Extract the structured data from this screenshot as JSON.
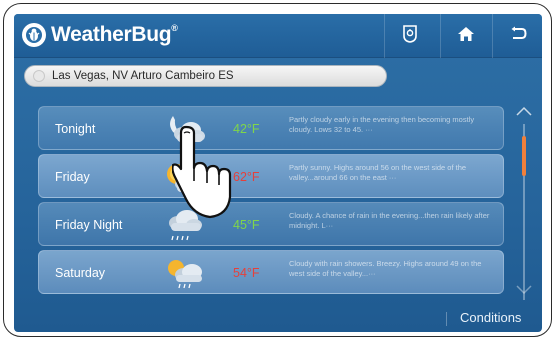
{
  "app": {
    "brand": "WeatherBug",
    "trademark": "®"
  },
  "nav": [
    {
      "name": "alerts-icon"
    },
    {
      "name": "home-icon"
    },
    {
      "name": "back-icon"
    }
  ],
  "location": {
    "value": "Las Vegas, NV Arturo Cambeiro ES"
  },
  "forecast": [
    {
      "period": "Tonight",
      "temp": "42°F",
      "tone": "cool",
      "icon": "partly-cloudy-night-icon",
      "desc": "Partly cloudy early in the evening then becoming mostly cloudy. Lows 32 to 45. ···"
    },
    {
      "period": "Friday",
      "temp": "62°F",
      "tone": "warm",
      "icon": "partly-sunny-icon",
      "desc": "Partly sunny. Highs around 56 on the west side of the valley...around 66 on the east ···"
    },
    {
      "period": "Friday Night",
      "temp": "45°F",
      "tone": "cool",
      "icon": "rain-cloud-icon",
      "desc": "Cloudy. A chance of rain in the evening...then rain likely after midnight. L···"
    },
    {
      "period": "Saturday",
      "temp": "54°F",
      "tone": "warm",
      "icon": "sun-rain-icon",
      "desc": "Cloudy with rain showers. Breezy. Highs around 49 on the west side of the valley...···"
    }
  ],
  "bottom": {
    "conditions_label": "Conditions"
  },
  "colors": {
    "cool_temp": "#7fd64a",
    "warm_temp": "#e5403b",
    "scroll_thumb": "#f0803c",
    "screen_blue": "#2a6aa1"
  }
}
